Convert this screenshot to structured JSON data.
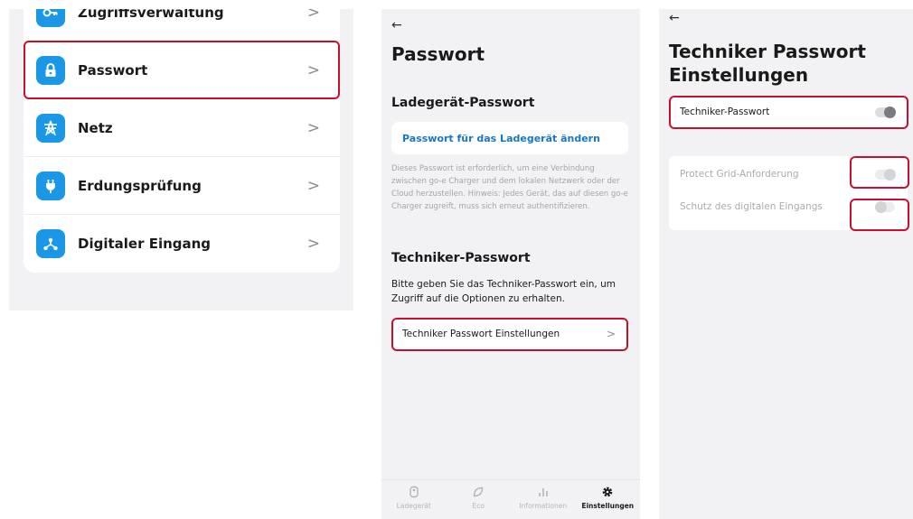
{
  "screen1": {
    "items": [
      {
        "label": "Zugriffsverwaltung",
        "icon": "key-icon"
      },
      {
        "label": "Passwort",
        "icon": "lock-icon"
      },
      {
        "label": "Netz",
        "icon": "power-pylon-icon"
      },
      {
        "label": "Erdungsprüfung",
        "icon": "plug-icon"
      },
      {
        "label": "Digitaler Eingang",
        "icon": "network-icon"
      }
    ],
    "chevron": ">"
  },
  "screen2": {
    "back": "←",
    "title": "Passwort",
    "charger_section_title": "Ladegerät-Passwort",
    "change_link": "Passwort für das Ladegerät ändern",
    "hint": "Dieses Passwort ist erforderlich, um eine Verbindung zwischen go-e Charger und dem lokalen Netzwerk oder der Cloud herzustellen. Hinweis: Jedes Gerät, das auf diesen go-e Charger zugreift, muss sich erneut authentifizieren.",
    "tech_section_title": "Techniker-Passwort",
    "tech_description": "Bitte geben Sie das Techniker-Passwort ein, um Zugriff auf die Optionen zu erhalten.",
    "tech_settings_row": "Techniker Passwort Einstellungen",
    "chevron": ">",
    "tabs": [
      {
        "label": "Ladegerät",
        "icon": "charger-icon"
      },
      {
        "label": "Eco",
        "icon": "leaf-icon"
      },
      {
        "label": "Informationen",
        "icon": "bar-chart-icon"
      },
      {
        "label": "Einstellungen",
        "icon": "gear-icon",
        "active": true
      }
    ]
  },
  "screen3": {
    "back": "←",
    "title_line1": "Techniker Passwort",
    "title_line2": "Einstellungen",
    "tech_password_label": "Techniker-Passwort",
    "tech_password_on": false,
    "protect_grid_label": "Protect Grid-Anforderung",
    "protect_grid_on": true,
    "digital_input_label": "Schutz des digitalen Eingangs",
    "digital_input_on": false
  },
  "colors": {
    "highlight": "#c8102e",
    "accent": "#1a98e6",
    "link": "#1677c8"
  }
}
